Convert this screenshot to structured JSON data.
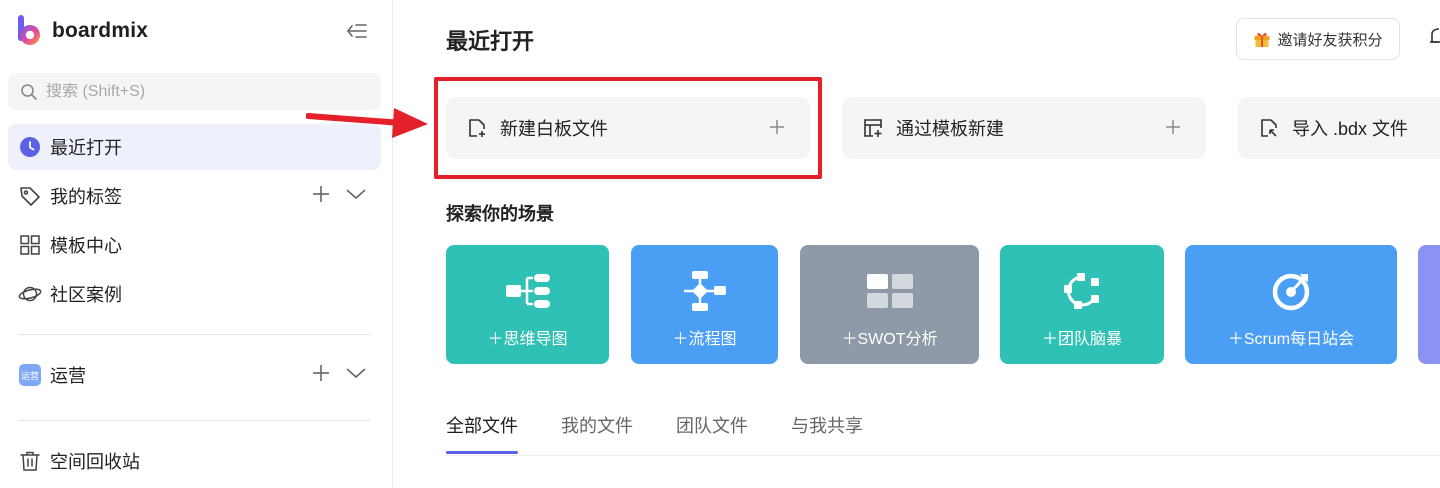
{
  "app": {
    "logo_text": "boardmix"
  },
  "sidebar": {
    "search_placeholder": "搜索 (Shift+S)",
    "items": [
      {
        "label": "最近打开",
        "icon": "clock-icon"
      },
      {
        "label": "我的标签",
        "icon": "tag-icon"
      },
      {
        "label": "模板中心",
        "icon": "grid-icon"
      },
      {
        "label": "社区案例",
        "icon": "planet-icon"
      }
    ],
    "team": {
      "badge": "运营",
      "label": "运营"
    },
    "trash_label": "空间回收站"
  },
  "header": {
    "title": "最近打开",
    "invite_label": "邀请好友获积分"
  },
  "actions": [
    {
      "label": "新建白板文件",
      "icon": "new-file-icon"
    },
    {
      "label": "通过模板新建",
      "icon": "template-icon"
    },
    {
      "label": "导入 .bdx 文件",
      "icon": "import-icon"
    }
  ],
  "scenes_title": "探索你的场景",
  "scenes": [
    {
      "label": "＋思维导图",
      "color": "#2fc1b5"
    },
    {
      "label": "＋流程图",
      "color": "#4a9ff5"
    },
    {
      "label": "＋SWOT分析",
      "color": "#8f9aa8"
    },
    {
      "label": "＋团队脑暴",
      "color": "#2fc1b5"
    },
    {
      "label": "＋Scrum每日站会",
      "color": "#4a9ff5"
    }
  ],
  "tabs": [
    {
      "label": "全部文件",
      "active": true
    },
    {
      "label": "我的文件",
      "active": false
    },
    {
      "label": "团队文件",
      "active": false
    },
    {
      "label": "与我共享",
      "active": false
    }
  ],
  "colors": {
    "accent": "#5b62e6",
    "highlight": "#e4202b"
  }
}
